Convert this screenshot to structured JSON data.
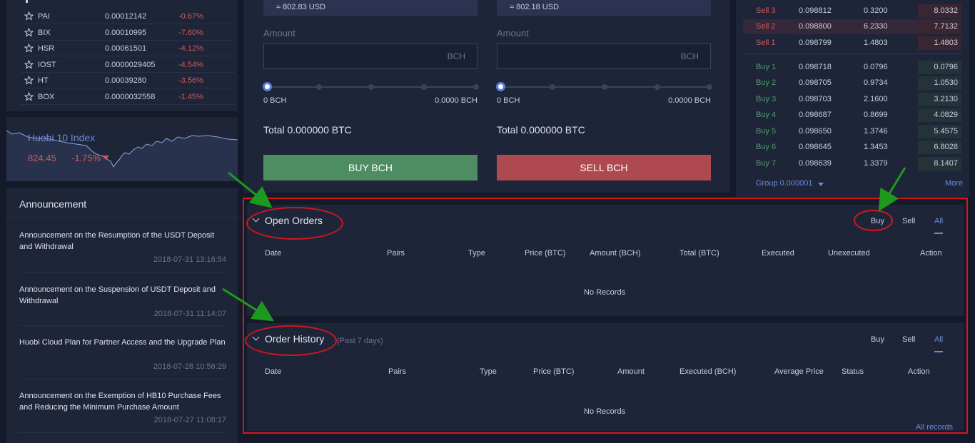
{
  "markets": [
    {
      "symbol": "PAI",
      "price": "0.00012142",
      "change": "-0.67%"
    },
    {
      "symbol": "BIX",
      "price": "0.00010995",
      "change": "-7.60%"
    },
    {
      "symbol": "HSR",
      "price": "0.00061501",
      "change": "-4.12%"
    },
    {
      "symbol": "IOST",
      "price": "0.0000029405",
      "change": "-4.54%"
    },
    {
      "symbol": "HT",
      "price": "0.00039280",
      "change": "-3.56%"
    },
    {
      "symbol": "BOX",
      "price": "0.0000032558",
      "change": "-1.45%"
    }
  ],
  "index": {
    "title": "Huobi 10 Index",
    "value": "824.45",
    "change": "-1.75%"
  },
  "announcement": {
    "title": "Announcement",
    "items": [
      {
        "title": "Announcement on the Resumption of the USDT Deposit and Withdrawal",
        "date": "2018-07-31 13:16:54"
      },
      {
        "title": "Announcement on the Suspension of USDT Deposit and Withdrawal",
        "date": "2018-07-31 11:14:07"
      },
      {
        "title": "Huobi Cloud Plan for Partner Access and the Upgrade Plan",
        "date": "2018-07-28 10:56:29"
      },
      {
        "title": "Announcement on the Exemption of HB10 Purchase Fees and Reducing the Minimum Purchase Amount",
        "date": "2018-07-27 11:08:17"
      }
    ]
  },
  "trade": {
    "buy": {
      "usd": "≈ 802.83 USD",
      "amount_label": "Amount",
      "unit": "BCH",
      "slider_left": "0 BCH",
      "slider_right": "0.0000 BCH",
      "total": "Total 0.000000 BTC",
      "button": "BUY BCH"
    },
    "sell": {
      "usd": "≈ 802.18 USD",
      "amount_label": "Amount",
      "unit": "BCH",
      "slider_left": "0 BCH",
      "slider_right": "0.0000 BCH",
      "total": "Total 0.000000 BTC",
      "button": "SELL BCH"
    }
  },
  "orderbook": {
    "sells": [
      {
        "level": "Sell 3",
        "price": "0.098812",
        "amount": "0.3200",
        "total": "8.0332",
        "depth": 0.2
      },
      {
        "level": "Sell 2",
        "price": "0.098800",
        "amount": "6.2330",
        "total": "7.7132",
        "depth": 0.2
      },
      {
        "level": "Sell 1",
        "price": "0.098799",
        "amount": "1.4803",
        "total": "1.4803",
        "depth": 0.2
      }
    ],
    "buys": [
      {
        "level": "Buy 1",
        "price": "0.098718",
        "amount": "0.0796",
        "total": "0.0796",
        "depth": 0.2
      },
      {
        "level": "Buy 2",
        "price": "0.098705",
        "amount": "0.9734",
        "total": "1.0530",
        "depth": 0.2
      },
      {
        "level": "Buy 3",
        "price": "0.098703",
        "amount": "2.1600",
        "total": "3.2130",
        "depth": 0.2
      },
      {
        "level": "Buy 4",
        "price": "0.098687",
        "amount": "0.8699",
        "total": "4.0829",
        "depth": 0.2
      },
      {
        "level": "Buy 5",
        "price": "0.098650",
        "amount": "1.3746",
        "total": "5.4575",
        "depth": 0.2
      },
      {
        "level": "Buy 6",
        "price": "0.098645",
        "amount": "1.3453",
        "total": "6.8028",
        "depth": 0.2
      },
      {
        "level": "Buy 7",
        "price": "0.098639",
        "amount": "1.3379",
        "total": "8.1407",
        "depth": 0.2
      }
    ],
    "group": "Group 0.000001",
    "more": "More"
  },
  "open_orders": {
    "title": "Open Orders",
    "filters": [
      "Buy",
      "Sell",
      "All"
    ],
    "columns": [
      "Date",
      "Pairs",
      "Type",
      "Price (BTC)",
      "Amount (BCH)",
      "Total (BTC)",
      "Executed",
      "Unexecuted",
      "Action"
    ],
    "empty": "No Records"
  },
  "order_history": {
    "title": "Order History",
    "subtitle": "(Past 7 days)",
    "filters": [
      "Buy",
      "Sell",
      "All"
    ],
    "columns": [
      "Date",
      "Pairs",
      "Type",
      "Price (BTC)",
      "Amount",
      "Executed (BCH)",
      "Average Price",
      "Status",
      "Action"
    ],
    "empty": "No Records",
    "all_records": "All records"
  },
  "colors": {
    "accent": "#6f89d6",
    "buy": "#4e8d61",
    "sell": "#ae4a4f",
    "annotation": "#d6151d",
    "arrow": "#1d9a1d"
  }
}
